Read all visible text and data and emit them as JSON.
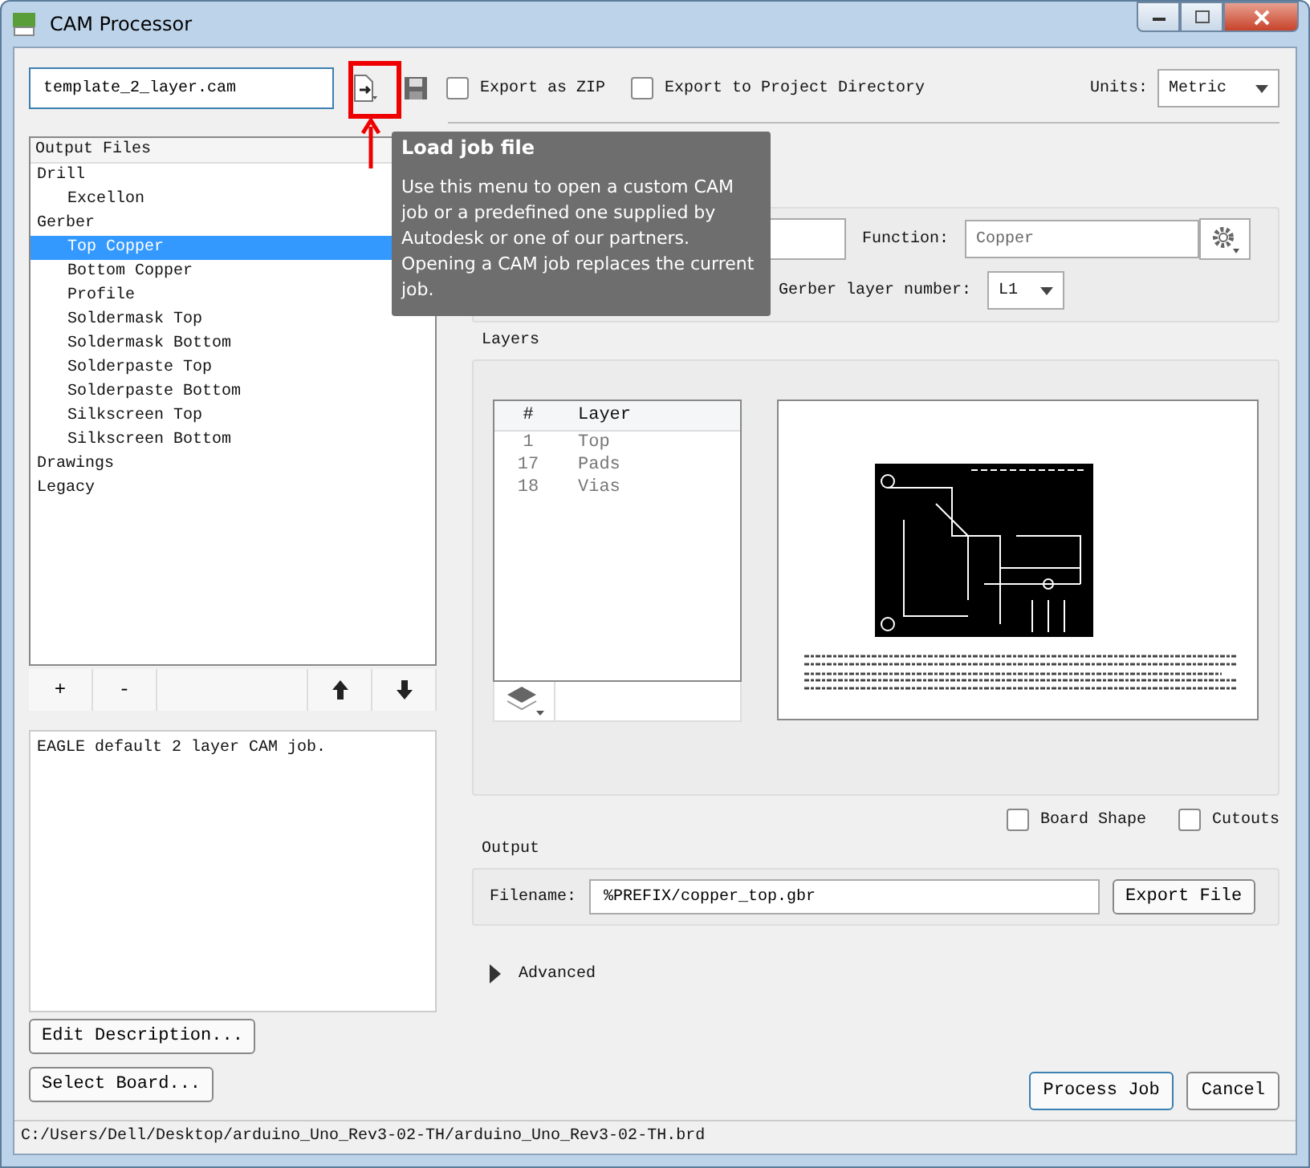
{
  "window": {
    "title": "CAM Processor"
  },
  "job_file": {
    "value": "template_2_layer.cam"
  },
  "export_as_zip": {
    "label": "Export as ZIP",
    "checked": false
  },
  "export_to_project_directory": {
    "label": "Export to Project Directory",
    "checked": false
  },
  "units": {
    "label": "Units:",
    "value": "Metric"
  },
  "output_files": {
    "header": "Output Files",
    "items": [
      {
        "label": "Drill",
        "selected": false,
        "children": [
          {
            "label": "Excellon",
            "selected": false
          }
        ]
      },
      {
        "label": "Gerber",
        "selected": false,
        "children": [
          {
            "label": "Top Copper",
            "selected": true
          },
          {
            "label": "Bottom Copper",
            "selected": false
          },
          {
            "label": "Profile",
            "selected": false
          },
          {
            "label": "Soldermask Top",
            "selected": false
          },
          {
            "label": "Soldermask Bottom",
            "selected": false
          },
          {
            "label": "Solderpaste Top",
            "selected": false
          },
          {
            "label": "Solderpaste Bottom",
            "selected": false
          },
          {
            "label": "Silkscreen Top",
            "selected": false
          },
          {
            "label": "Silkscreen Bottom",
            "selected": false
          }
        ]
      },
      {
        "label": "Drawings",
        "selected": false
      },
      {
        "label": "Legacy",
        "selected": false
      }
    ]
  },
  "list_toolbar": {
    "add": "+",
    "remove": "-"
  },
  "description": "EAGLE default 2 layer CAM job.",
  "edit_description_button": "Edit Description...",
  "select_board_button": "Select Board...",
  "function": {
    "label": "Function:",
    "value": "Copper"
  },
  "gerber_layer_number": {
    "label": "Gerber layer number:",
    "value": "L1"
  },
  "layers": {
    "title": "Layers",
    "columns": [
      "#",
      "Layer"
    ],
    "rows": [
      {
        "number": "1",
        "name": "Top"
      },
      {
        "number": "17",
        "name": "Pads"
      },
      {
        "number": "18",
        "name": "Vias"
      }
    ]
  },
  "board_shape": {
    "label": "Board Shape",
    "checked": false
  },
  "cutouts": {
    "label": "Cutouts",
    "checked": false
  },
  "output": {
    "title": "Output",
    "filename_label": "Filename:",
    "filename": "%PREFIX/copper_top.gbr",
    "export_button": "Export File"
  },
  "advanced": {
    "label": "Advanced",
    "expanded": false
  },
  "process_job_button": "Process Job",
  "cancel_button": "Cancel",
  "tooltip": {
    "title": "Load job file",
    "text": "Use this menu to open a custom CAM job or a predefined one supplied by Autodesk or one of our partners. Opening a CAM job replaces the current job."
  },
  "status_bar": {
    "path": "C:/Users/Dell/Desktop/arduino_Uno_Rev3-02-TH/arduino_Uno_Rev3-02-TH.brd"
  }
}
